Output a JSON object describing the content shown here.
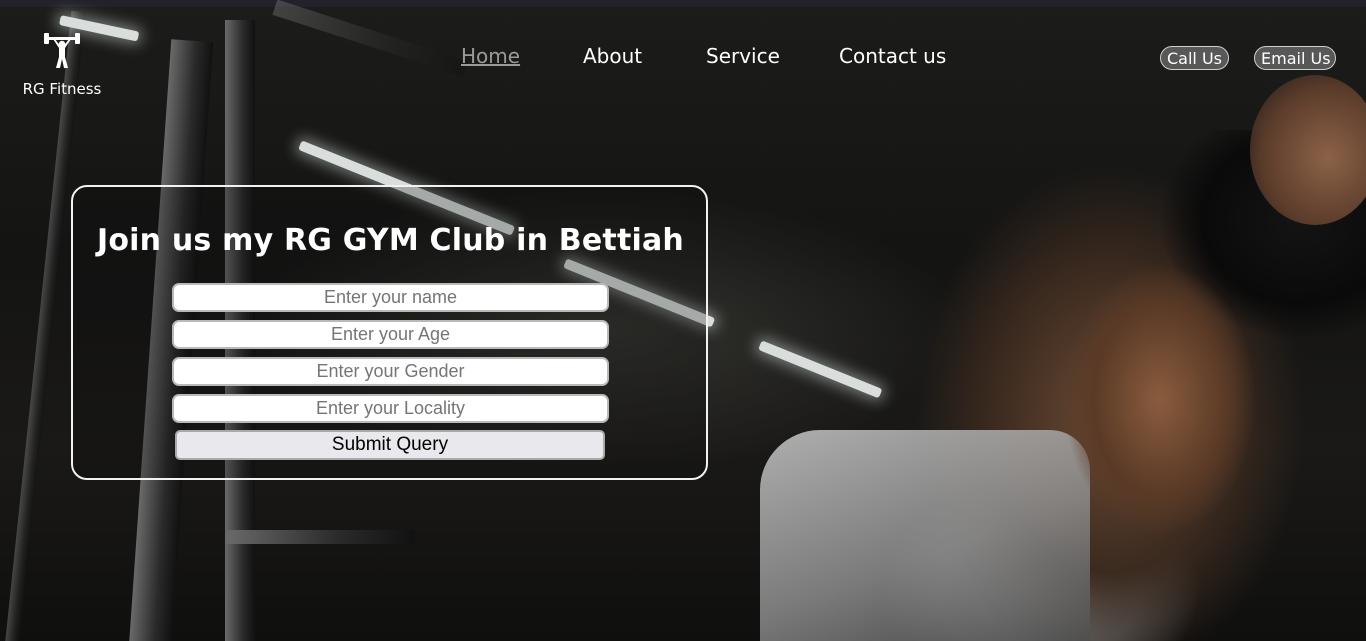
{
  "brand": {
    "name": "RG Fitness",
    "icon": "weightlifter-icon"
  },
  "nav": {
    "items": [
      {
        "label": "Home",
        "active": true
      },
      {
        "label": "About",
        "active": false
      },
      {
        "label": "Service",
        "active": false
      },
      {
        "label": "Contact us",
        "active": false
      }
    ]
  },
  "header_buttons": {
    "call": "Call Us",
    "email": "Email Us"
  },
  "form": {
    "title": "Join us my RG GYM Club in Bettiah",
    "name_placeholder": "Enter your name",
    "age_placeholder": "Enter your Age",
    "gender_placeholder": "Enter your Gender",
    "locality_placeholder": "Enter your Locality",
    "submit_label": "Submit Query"
  },
  "colors": {
    "nav_text": "#ffffff",
    "nav_active": "#9a9a9a",
    "card_border": "#f2f2f2",
    "button_bg": "#e9e9ed"
  }
}
